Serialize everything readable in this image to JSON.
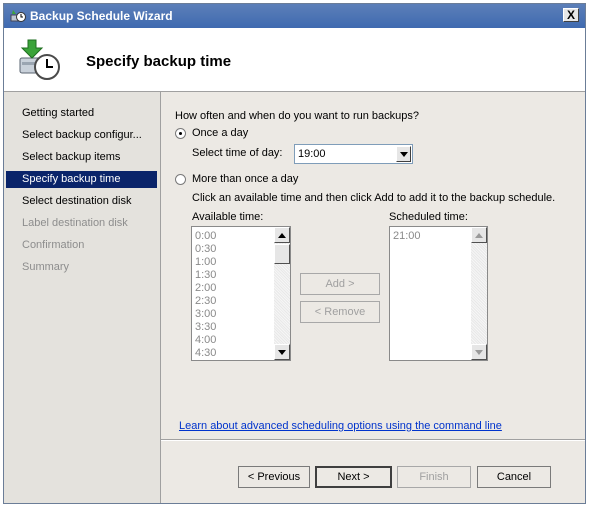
{
  "window": {
    "title": "Backup Schedule Wizard",
    "close_label": "X"
  },
  "header": {
    "title": "Specify backup time",
    "icon": "backup-clock-icon"
  },
  "nav": {
    "items": [
      {
        "label": "Getting started",
        "state": "normal"
      },
      {
        "label": "Select backup configur...",
        "state": "normal"
      },
      {
        "label": "Select backup items",
        "state": "normal"
      },
      {
        "label": "Specify backup time",
        "state": "selected"
      },
      {
        "label": "Select destination disk",
        "state": "normal"
      },
      {
        "label": "Label destination disk",
        "state": "disabled"
      },
      {
        "label": "Confirmation",
        "state": "disabled"
      },
      {
        "label": "Summary",
        "state": "disabled"
      }
    ]
  },
  "main": {
    "question": "How often and when do you want to run backups?",
    "once_label": "Once a day",
    "select_time_label": "Select time of day:",
    "select_time_value": "19:00",
    "more_label": "More than once a day",
    "instruction": "Click an available time and then click Add to add it to the backup schedule.",
    "available_label": "Available time:",
    "scheduled_label": "Scheduled time:",
    "available_times": [
      "0:00",
      "0:30",
      "1:00",
      "1:30",
      "2:00",
      "2:30",
      "3:00",
      "3:30",
      "4:00",
      "4:30"
    ],
    "scheduled_times": [
      "21:00"
    ],
    "add_label": "Add >",
    "remove_label": "< Remove",
    "link": "Learn about advanced scheduling options using the command line"
  },
  "footer": {
    "previous": "< Previous",
    "next": "Next >",
    "finish": "Finish",
    "cancel": "Cancel"
  }
}
